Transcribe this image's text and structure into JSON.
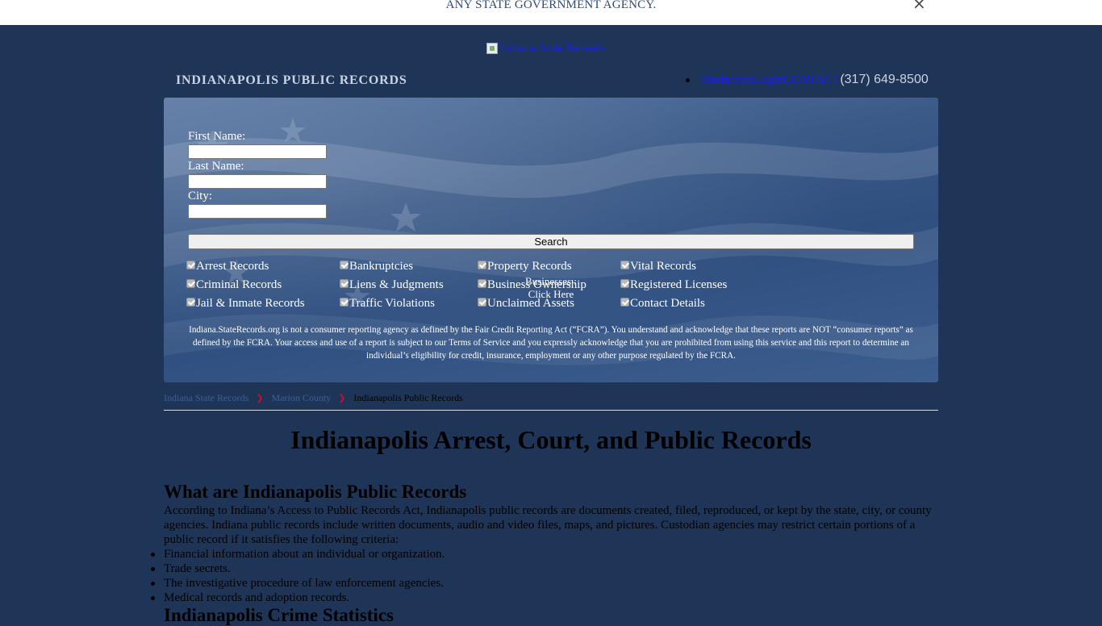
{
  "notice": {
    "text": "ANY STATE GOVERNMENT AGENCY.",
    "close": "×"
  },
  "logo": {
    "alt": "Indiana State Records"
  },
  "header": {
    "site_title": "INDIANAPOLIS PUBLIC RECORDS",
    "nav": [
      "Businesses",
      "Login",
      "CONTACT"
    ],
    "phone": "(317) 649-8500"
  },
  "search": {
    "first_name_label": "First Name:",
    "last_name_label": "Last Name:",
    "city_label": "City:",
    "first_name_value": "",
    "last_name_value": "",
    "city_value": "",
    "button": "Search",
    "checkboxes": [
      [
        "Arrest Records",
        "Criminal Records",
        "Jail & Inmate Records"
      ],
      [
        "Bankruptcies",
        "Liens & Judgments",
        "Traffic Violations"
      ],
      [
        "Property Records",
        "Business Ownership",
        "Unclaimed Assets"
      ],
      [
        "Vital Records",
        "Registered Licenses",
        "Contact Details"
      ]
    ],
    "businesses_overlay": [
      "Businesses :",
      "Click Here"
    ],
    "disclaimer": "Indiana.StateRecords.org is not a consumer reporting agency as defined by the Fair Credit Reporting Act (“FCRA”). You understand and acknowledge that these reports are NOT “consumer reports” as defined by the FCRA. Your access and use of a report is subject to our Terms of Service and you expressly acknowledge that you are prohibited from using this service and this report to determine an individual’s eligibility for credit, insurance, employment or any other purpose regulated by the FCRA."
  },
  "breadcrumb": [
    "Indiana State Records",
    "Marion County",
    "Indianapolis Public Records"
  ],
  "content": {
    "title": "Indianapolis Arrest, Court, and Public Records",
    "section1_heading": "What are Indianapolis Public Records",
    "section1_text": "According to Indiana’s Access to Public Records Act, Indianapolis public records are documents created, filed, reproduced, or kept by the state, city, or county agencies. Indiana public records include written documents, audio and video files, maps, and pictures. Custodian agencies may restrict certain portions of a public record if it satisfies the following criteria:",
    "criteria": [
      "Financial information about an individual or organization.",
      "Trade secrets.",
      "The investigative procedure of law enforcement agencies.",
      "Medical records and adoption records."
    ],
    "section2_heading": "Indianapolis Crime Statistics"
  }
}
